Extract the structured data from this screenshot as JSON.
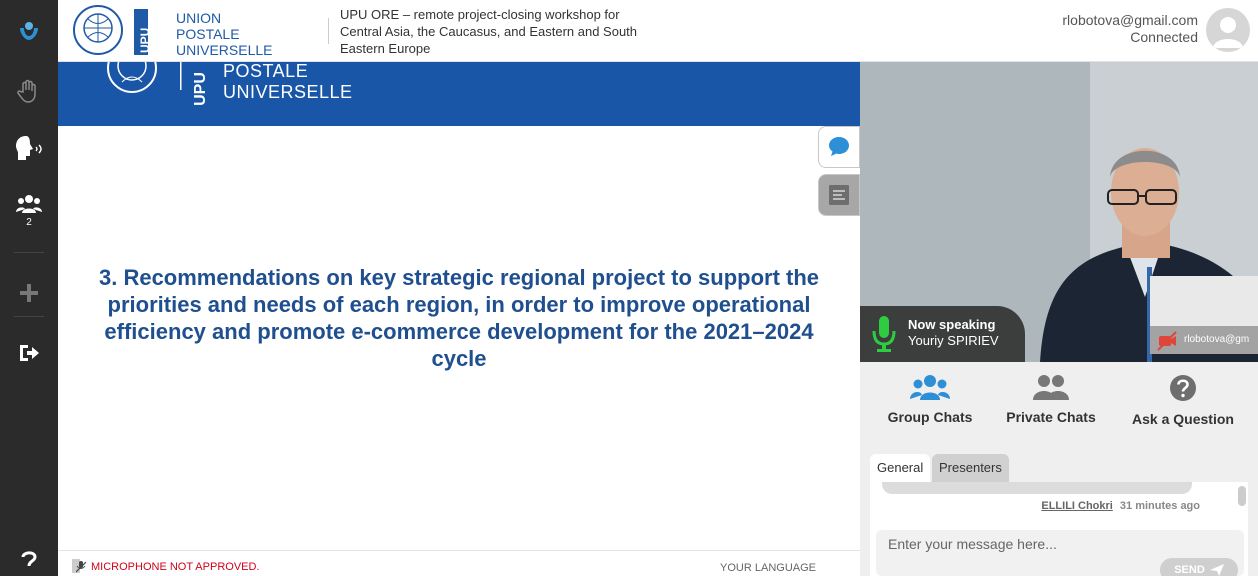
{
  "rail": {
    "participants_count": "2"
  },
  "header": {
    "logo_lines": [
      "UNION",
      "POSTALE",
      "UNIVERSELLE"
    ],
    "logo_abbrev": "UPU",
    "event_title": "UPU ORE – remote project-closing workshop for Central Asia, the Caucasus, and Eastern and South Eastern Europe",
    "user_email": "rlobotova@gmail.com",
    "user_status": "Connected"
  },
  "slide": {
    "band_lines": [
      "POSTALE",
      "UNIVERSELLE"
    ],
    "band_abbrev": "UPU",
    "heading": "3. Recommendations on key strategic regional project to support the priorities and needs of each region, in order to improve operational efficiency and promote e-commerce development for the 2021–2024 cycle"
  },
  "footer": {
    "mic_warning": "MICROPHONE NOT APPROVED.",
    "language_label": "YOUR LANGUAGE"
  },
  "video": {
    "now_speaking_label": "Now speaking",
    "speaker_name": "Youriy SPIRIEV",
    "selfview_name": "rlobotova@gm"
  },
  "panel": {
    "tabs": [
      {
        "label": "Group Chats"
      },
      {
        "label": "Private Chats"
      },
      {
        "label": "Ask a Question"
      }
    ],
    "subtabs": [
      {
        "label": "General",
        "active": true
      },
      {
        "label": "Presenters",
        "active": false
      }
    ],
    "last_message": {
      "author": "ELLILI Chokri",
      "time": "31 minutes ago"
    },
    "input_placeholder": "Enter your message here...",
    "send_label": "SEND"
  },
  "colors": {
    "brand_blue": "#1a56a8",
    "heading_blue": "#1f4f8f",
    "rail_bg": "#2b2b2b",
    "mic_green": "#2ecc40",
    "group_chats_blue": "#2d8fd5",
    "warning_red": "#d0021b"
  }
}
